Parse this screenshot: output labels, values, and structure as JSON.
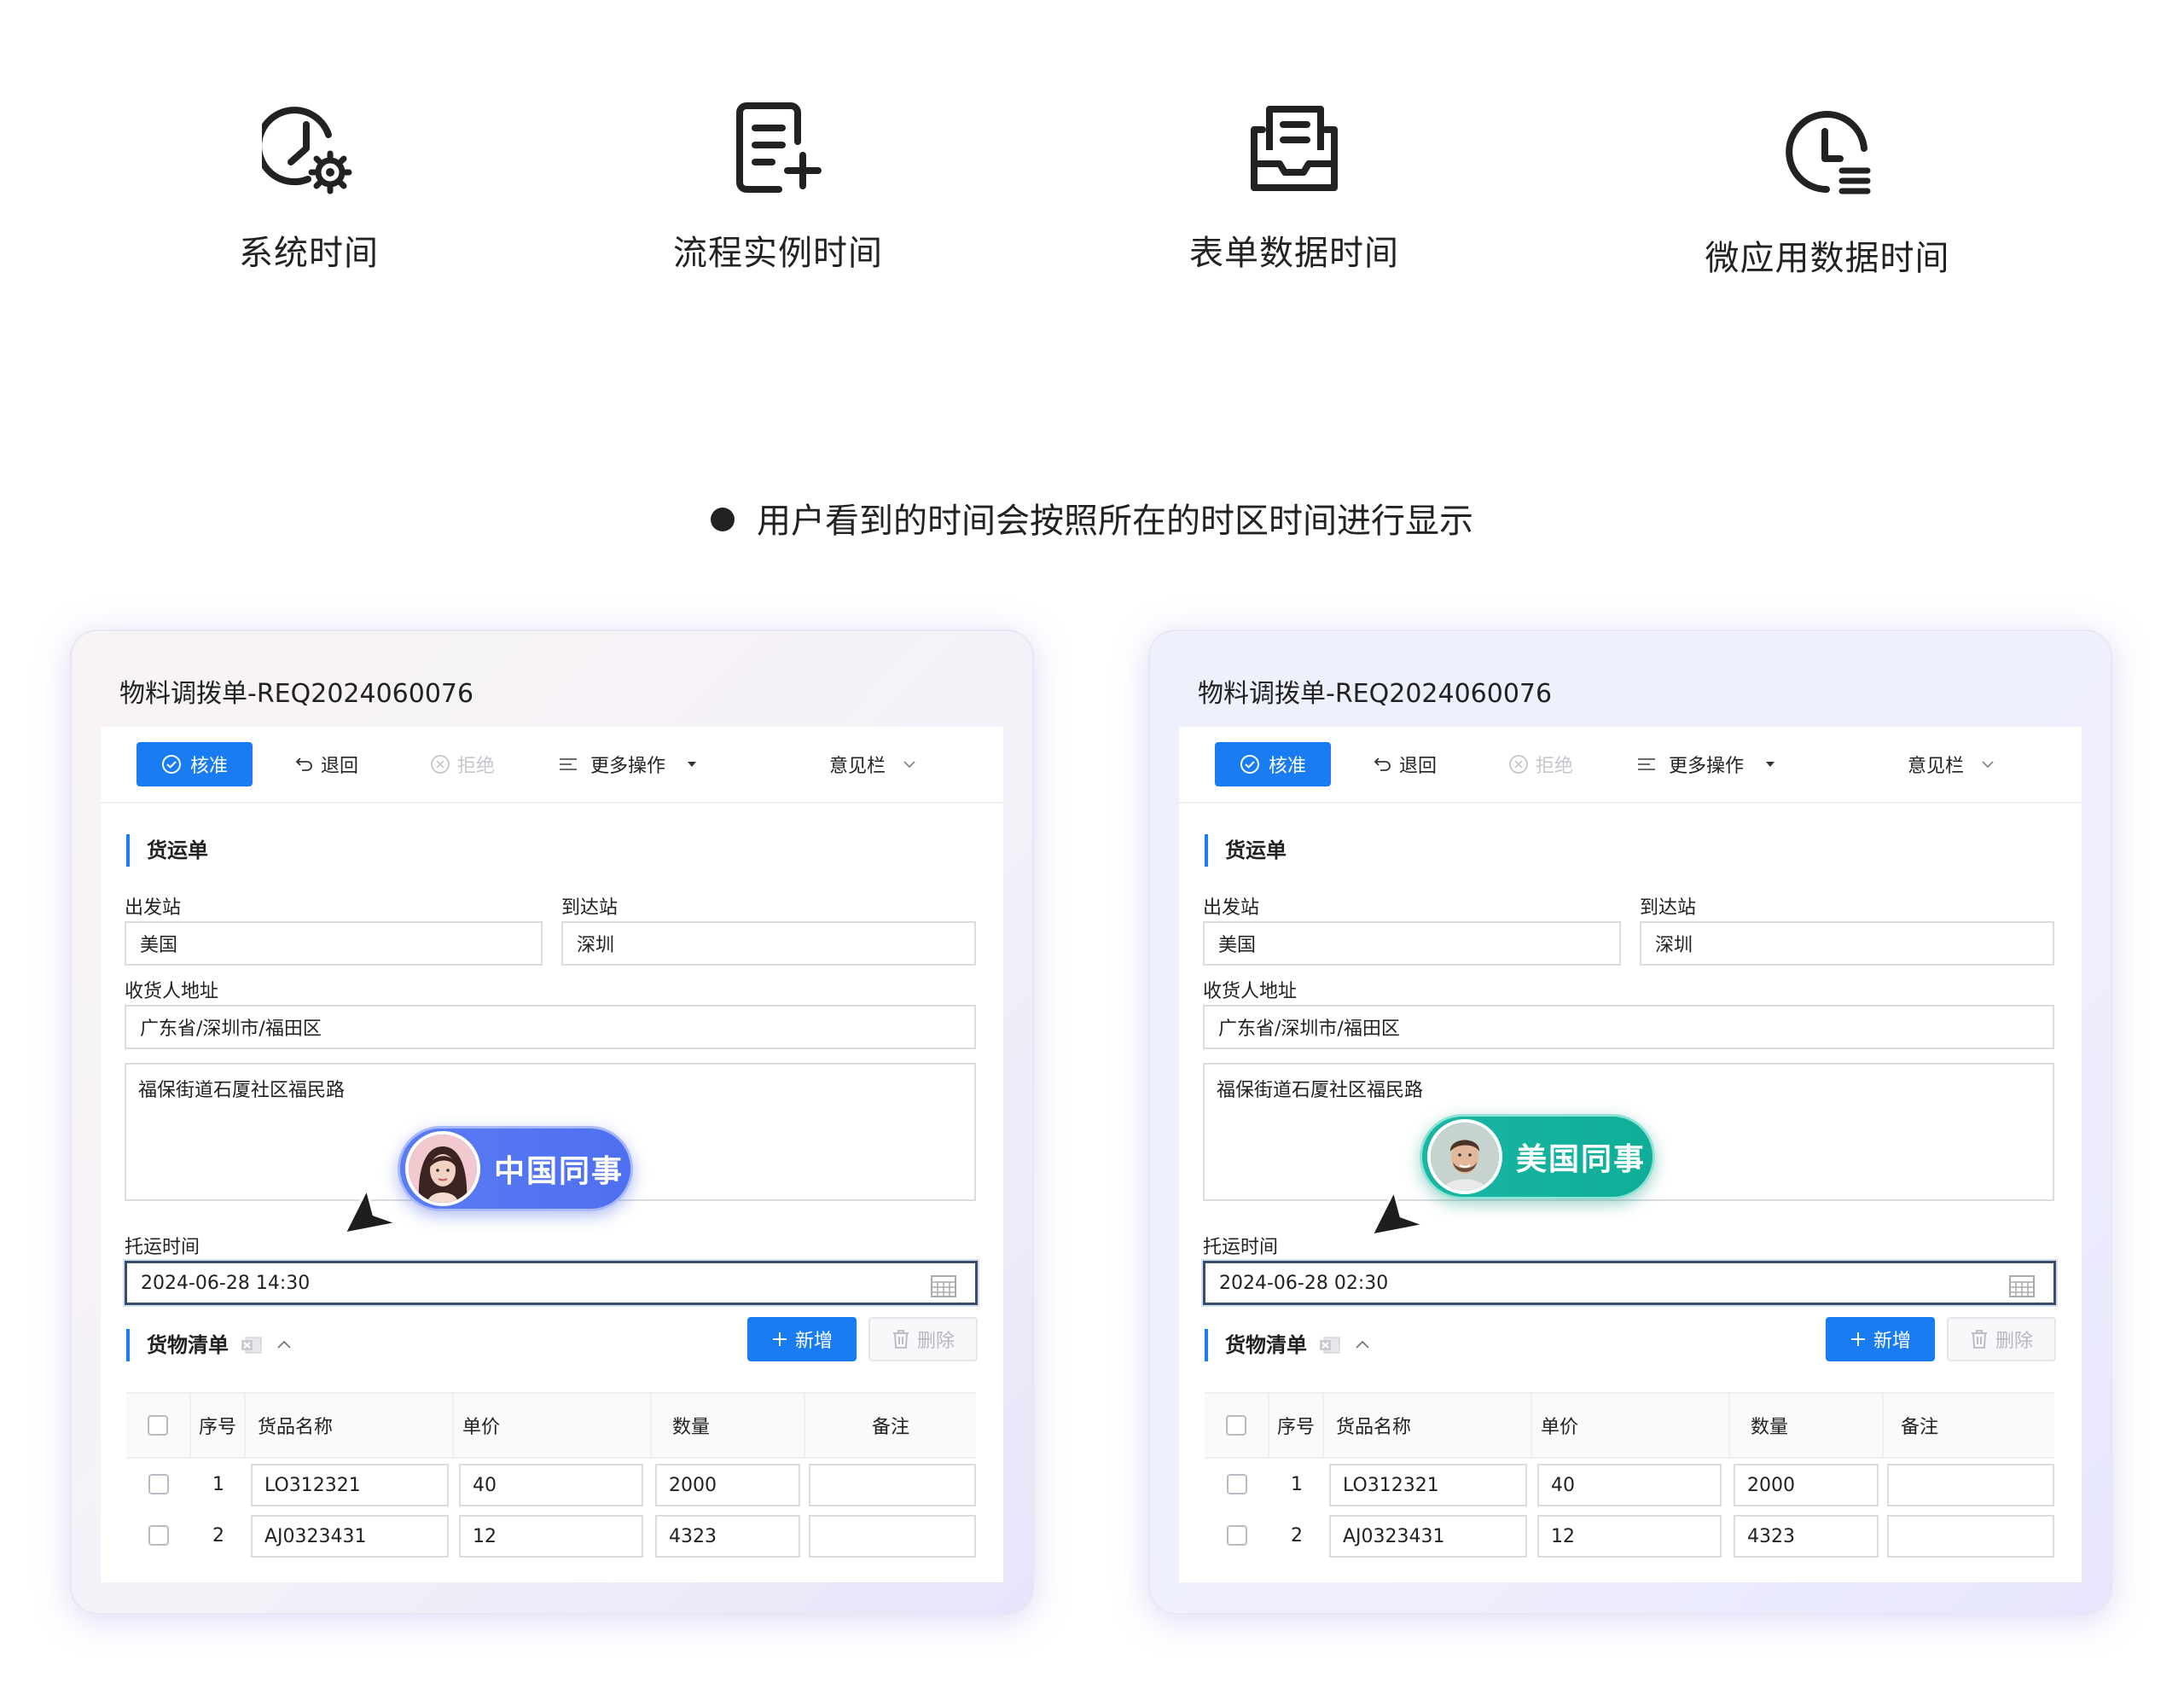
{
  "features": [
    {
      "label": "系统时间",
      "icon": "clock-gear-icon"
    },
    {
      "label": "流程实例时间",
      "icon": "document-add-icon"
    },
    {
      "label": "表单数据时间",
      "icon": "form-tray-icon"
    },
    {
      "label": "微应用数据时间",
      "icon": "clock-list-icon"
    }
  ],
  "note": "用户看到的时间会按照所在的时区时间进行显示",
  "cards": [
    {
      "title": "物料调拨单-REQ2024060076",
      "toolbar": {
        "approve": "核准",
        "return": "退回",
        "reject": "拒绝",
        "more": "更多操作",
        "opinion": "意见栏"
      },
      "section1": "货运单",
      "labels": {
        "depart": "出发站",
        "arrive": "到达站",
        "address": "收货人地址",
        "ship_time": "托运时间"
      },
      "values": {
        "depart": "美国",
        "arrive": "深圳",
        "region": "广东省/深圳市/福田区",
        "street": "福保街道石厦社区福民路",
        "ship_time": "2024-06-28 14:30"
      },
      "section2": "货物清单",
      "add": "新增",
      "delete": "删除",
      "columns": [
        "序号",
        "货品名称",
        "单价",
        "数量",
        "备注"
      ],
      "rows": [
        {
          "no": "1",
          "name": "LO312321",
          "price": "40",
          "qty": "2000",
          "remark": ""
        },
        {
          "no": "2",
          "name": "AJ0323431",
          "price": "12",
          "qty": "4323",
          "remark": ""
        }
      ],
      "badge": "中国同事"
    },
    {
      "title": "物料调拨单-REQ2024060076",
      "toolbar": {
        "approve": "核准",
        "return": "退回",
        "reject": "拒绝",
        "more": "更多操作",
        "opinion": "意见栏"
      },
      "section1": "货运单",
      "labels": {
        "depart": "出发站",
        "arrive": "到达站",
        "address": "收货人地址",
        "ship_time": "托运时间"
      },
      "values": {
        "depart": "美国",
        "arrive": "深圳",
        "region": "广东省/深圳市/福田区",
        "street": "福保街道石厦社区福民路",
        "ship_time": "2024-06-28 02:30"
      },
      "section2": "货物清单",
      "add": "新增",
      "delete": "删除",
      "columns": [
        "序号",
        "货品名称",
        "单价",
        "数量",
        "备注"
      ],
      "rows": [
        {
          "no": "1",
          "name": "LO312321",
          "price": "40",
          "qty": "2000",
          "remark": ""
        },
        {
          "no": "2",
          "name": "AJ0323431",
          "price": "12",
          "qty": "4323",
          "remark": ""
        }
      ],
      "badge": "美国同事"
    }
  ],
  "colors": {
    "primary": "#1a7cf2",
    "badge_cn": "#5573f2",
    "badge_us": "#14b29e"
  }
}
